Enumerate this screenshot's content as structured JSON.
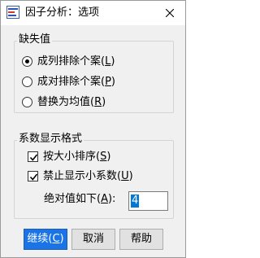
{
  "window": {
    "title": "因子分析：选项",
    "icons": {
      "app": "factor-analysis-icon",
      "close": "close-icon"
    }
  },
  "missing_values": {
    "title": "缺失值",
    "options": [
      {
        "label_pre": "成列排除个案(",
        "mnemonic": "L",
        "label_post": ")",
        "selected": true
      },
      {
        "label_pre": "成对排除个案(",
        "mnemonic": "P",
        "label_post": ")",
        "selected": false
      },
      {
        "label_pre": "替换为均值(",
        "mnemonic": "R",
        "label_post": ")",
        "selected": false
      }
    ]
  },
  "coef_format": {
    "title": "系数显示格式",
    "sort_by_size": {
      "label_pre": "按大小排序(",
      "mnemonic": "S",
      "label_post": ")",
      "checked": true
    },
    "suppress_small": {
      "label_pre": "禁止显示小系数(",
      "mnemonic": "U",
      "label_post": ")",
      "checked": true
    },
    "abs_value": {
      "label_pre": "绝对值如下(",
      "mnemonic": "A",
      "label_post": "):",
      "value": "4"
    }
  },
  "buttons": {
    "continue": {
      "label_pre": "继续(",
      "mnemonic": "C",
      "label_post": ")"
    },
    "cancel": {
      "label": "取消"
    },
    "help": {
      "label": "帮助"
    }
  },
  "colors": {
    "primary_button": "#1a74e6",
    "selection": "#0078d7"
  }
}
